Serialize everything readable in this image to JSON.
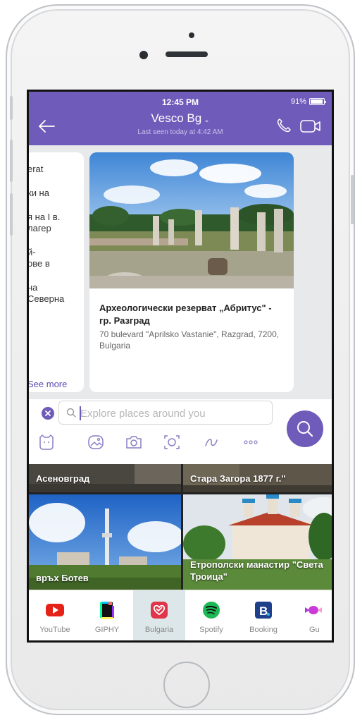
{
  "status": {
    "time": "12:45 PM",
    "battery": "91%"
  },
  "chat": {
    "name": "Vesco Bg",
    "last_seen": "Last seen today at 4:42 AM"
  },
  "left_message": {
    "lines": [
      "erat",
      "",
      "ки на",
      "",
      "я на I в.",
      "лагер",
      "",
      "й-",
      "ове в",
      "",
      "на",
      "Северна"
    ],
    "see_more": "See more"
  },
  "place_card": {
    "title": "Археологически резерват „Абритус\" - гр. Разград",
    "address": "70 bulevard \"Aprilsko Vastanie\", Razgrad, 7200, Bulgaria"
  },
  "search": {
    "placeholder": "Explore places around you"
  },
  "tools": [
    "sticker-icon",
    "gallery-icon",
    "camera-icon",
    "lens-icon",
    "doodle-icon",
    "more-icon"
  ],
  "results": [
    {
      "label": "Асеновград"
    },
    {
      "label": "Стара Загора 1877 г.\""
    },
    {
      "label": "връх Ботев"
    },
    {
      "label": "Етрополски манастир \"Света Троица\""
    }
  ],
  "apps": [
    {
      "label": "YouTube",
      "icon": "youtube-icon"
    },
    {
      "label": "GIPHY",
      "icon": "giphy-icon"
    },
    {
      "label": "Bulgaria",
      "icon": "bulgaria-icon"
    },
    {
      "label": "Spotify",
      "icon": "spotify-icon"
    },
    {
      "label": "Booking",
      "icon": "booking-icon"
    },
    {
      "label": "Gu",
      "icon": "candy-icon"
    }
  ],
  "colors": {
    "accent": "#6f5cba",
    "youtube": "#e62117",
    "spotify": "#1db954",
    "booking": "#1e3f8a",
    "bulgaria": "#e0344a"
  }
}
